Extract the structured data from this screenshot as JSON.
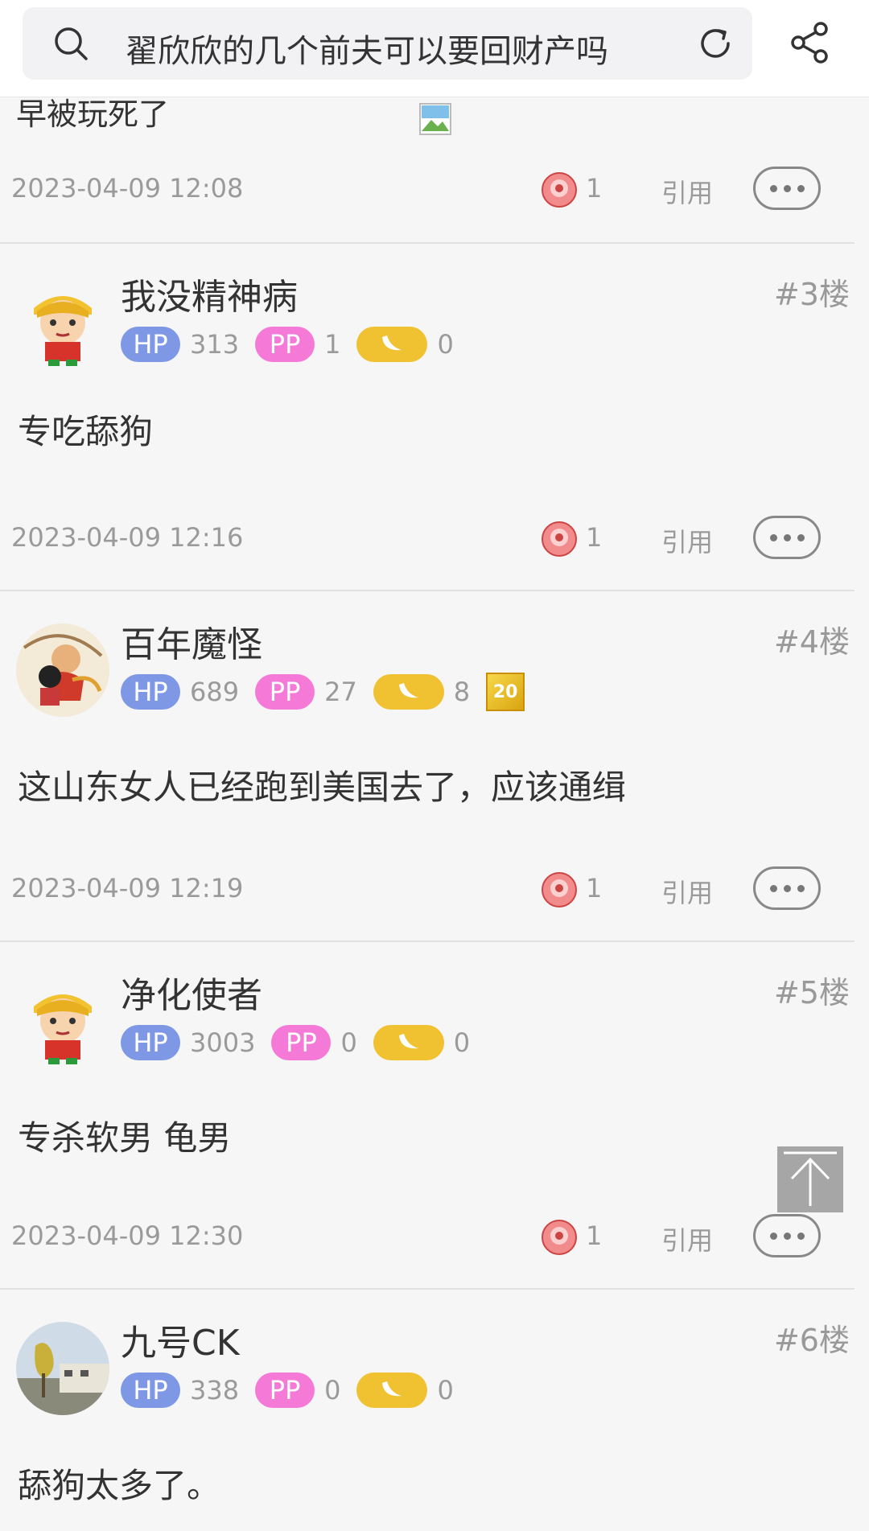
{
  "search": {
    "query": "翟欣欣的几个前夫可以要回财产吗"
  },
  "posts": [
    {
      "partial_text": "早被玩死了",
      "time": "2023-04-09 12:08",
      "likes": "1",
      "quote": "引用"
    },
    {
      "username": "我没精神病",
      "floor": "#3楼",
      "hp": "313",
      "pp": "1",
      "banana": "0",
      "content": "专吃舔狗",
      "time": "2023-04-09 12:16",
      "likes": "1",
      "quote": "引用"
    },
    {
      "username": "百年魔怪",
      "floor": "#4楼",
      "hp": "689",
      "pp": "27",
      "banana": "8",
      "level": "20",
      "content": "这山东女人已经跑到美国去了，应该通缉",
      "time": "2023-04-09 12:19",
      "likes": "1",
      "quote": "引用"
    },
    {
      "username": "净化使者",
      "floor": "#5楼",
      "hp": "3003",
      "pp": "0",
      "banana": "0",
      "content": "专杀软男 龟男",
      "time": "2023-04-09 12:30",
      "likes": "1",
      "quote": "引用"
    },
    {
      "username": "九号CK",
      "floor": "#6楼",
      "hp": "338",
      "pp": "0",
      "banana": "0",
      "content": "舔狗太多了。"
    }
  ],
  "badges": {
    "hp": "HP",
    "pp": "PP"
  },
  "icons": {
    "search": "search-icon",
    "refresh": "refresh-icon",
    "share": "share-icon",
    "like": "like-icon",
    "more": "more-icon",
    "banana": "banana-icon",
    "to_top": "arrow-up-icon"
  },
  "colors": {
    "hp": "#7e98e6",
    "pp": "#f57ad7",
    "banana": "#f0c232"
  }
}
